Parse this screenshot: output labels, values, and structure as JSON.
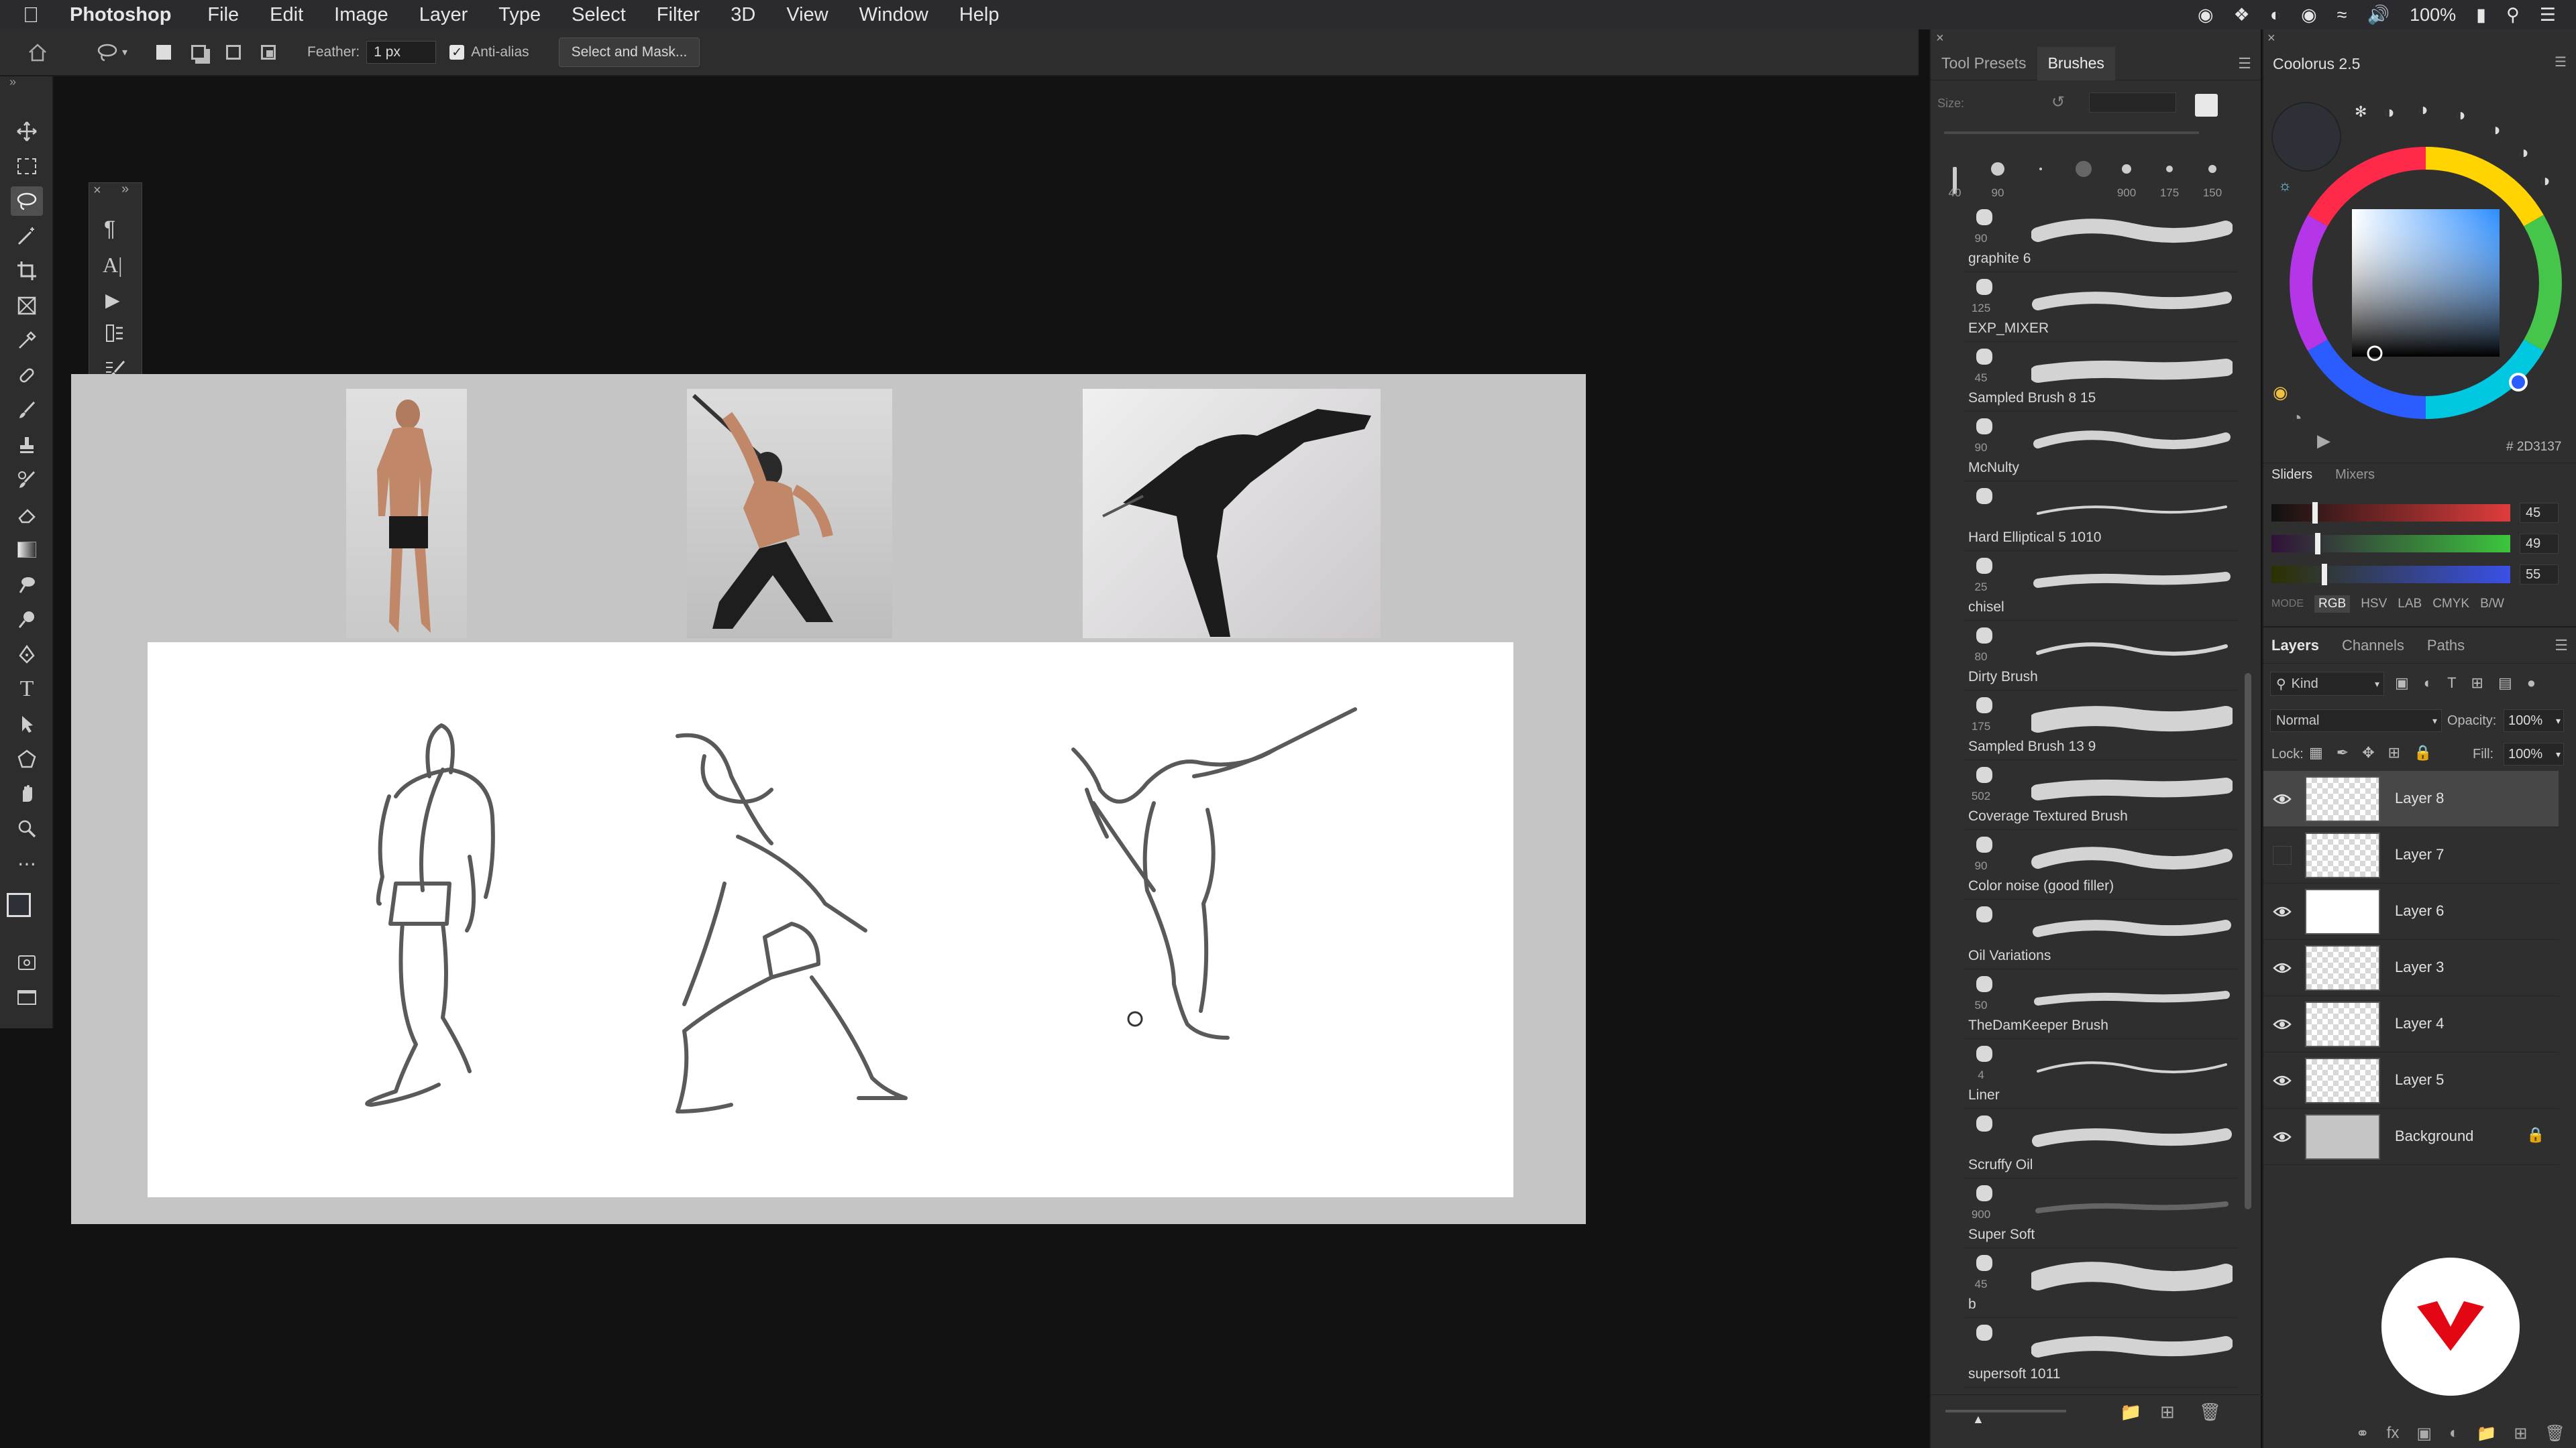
{
  "menubar": {
    "app": "Photoshop",
    "items": [
      "File",
      "Edit",
      "Image",
      "Layer",
      "Type",
      "Select",
      "Filter",
      "3D",
      "View",
      "Window",
      "Help"
    ],
    "battery": "100%"
  },
  "options": {
    "feather_label": "Feather:",
    "feather_value": "1 px",
    "antialias_label": "Anti-alias",
    "select_mask": "Select and Mask..."
  },
  "brushes": {
    "tabs": [
      "Tool Presets",
      "Brushes"
    ],
    "size_label": "Size:",
    "recent_sizes": [
      "40",
      "90",
      "",
      "",
      "900",
      "175",
      "150"
    ],
    "list": [
      {
        "size": "90",
        "name": "graphite 6"
      },
      {
        "size": "125",
        "name": "EXP_MIXER"
      },
      {
        "size": "45",
        "name": "Sampled Brush 8 15"
      },
      {
        "size": "90",
        "name": "McNulty"
      },
      {
        "size": "",
        "name": "Hard Elliptical 5 1010"
      },
      {
        "size": "25",
        "name": "chisel"
      },
      {
        "size": "80",
        "name": "Dirty Brush"
      },
      {
        "size": "175",
        "name": "Sampled Brush 13 9"
      },
      {
        "size": "502",
        "name": "Coverage Textured Brush"
      },
      {
        "size": "90",
        "name": "Color noise (good filler)"
      },
      {
        "size": "",
        "name": "Oil Variations"
      },
      {
        "size": "50",
        "name": "TheDamKeeper Brush"
      },
      {
        "size": "4",
        "name": "Liner"
      },
      {
        "size": "",
        "name": "Scruffy Oil"
      },
      {
        "size": "900",
        "name": "Super Soft"
      },
      {
        "size": "45",
        "name": "b"
      },
      {
        "size": "",
        "name": "supersoft 1011"
      }
    ]
  },
  "colorus": {
    "title": "Coolorus 2.5",
    "hex": "2D3137",
    "tabs": [
      "Sliders",
      "Mixers"
    ],
    "r": "45",
    "g": "49",
    "b": "55",
    "mode_label": "MODE",
    "modes": [
      "RGB",
      "HSV",
      "LAB",
      "CMYK",
      "B/W"
    ]
  },
  "layers": {
    "tabs": [
      "Layers",
      "Channels",
      "Paths"
    ],
    "kind": "Kind",
    "blend": "Normal",
    "opacity_label": "Opacity:",
    "opacity": "100%",
    "lock_label": "Lock:",
    "fill_label": "Fill:",
    "fill": "100%",
    "items": [
      {
        "name": "Layer 8",
        "visible": true,
        "selected": true
      },
      {
        "name": "Layer 7",
        "visible": false
      },
      {
        "name": "Layer 6",
        "visible": true
      },
      {
        "name": "Layer 3",
        "visible": true
      },
      {
        "name": "Layer 4",
        "visible": true
      },
      {
        "name": "Layer 5",
        "visible": true
      },
      {
        "name": "Background",
        "visible": true,
        "locked": true
      }
    ]
  },
  "colors": {
    "accent_red": "#e30613",
    "slider_r": "#e04040",
    "slider_g": "#40c040",
    "slider_b": "#4060e0"
  }
}
